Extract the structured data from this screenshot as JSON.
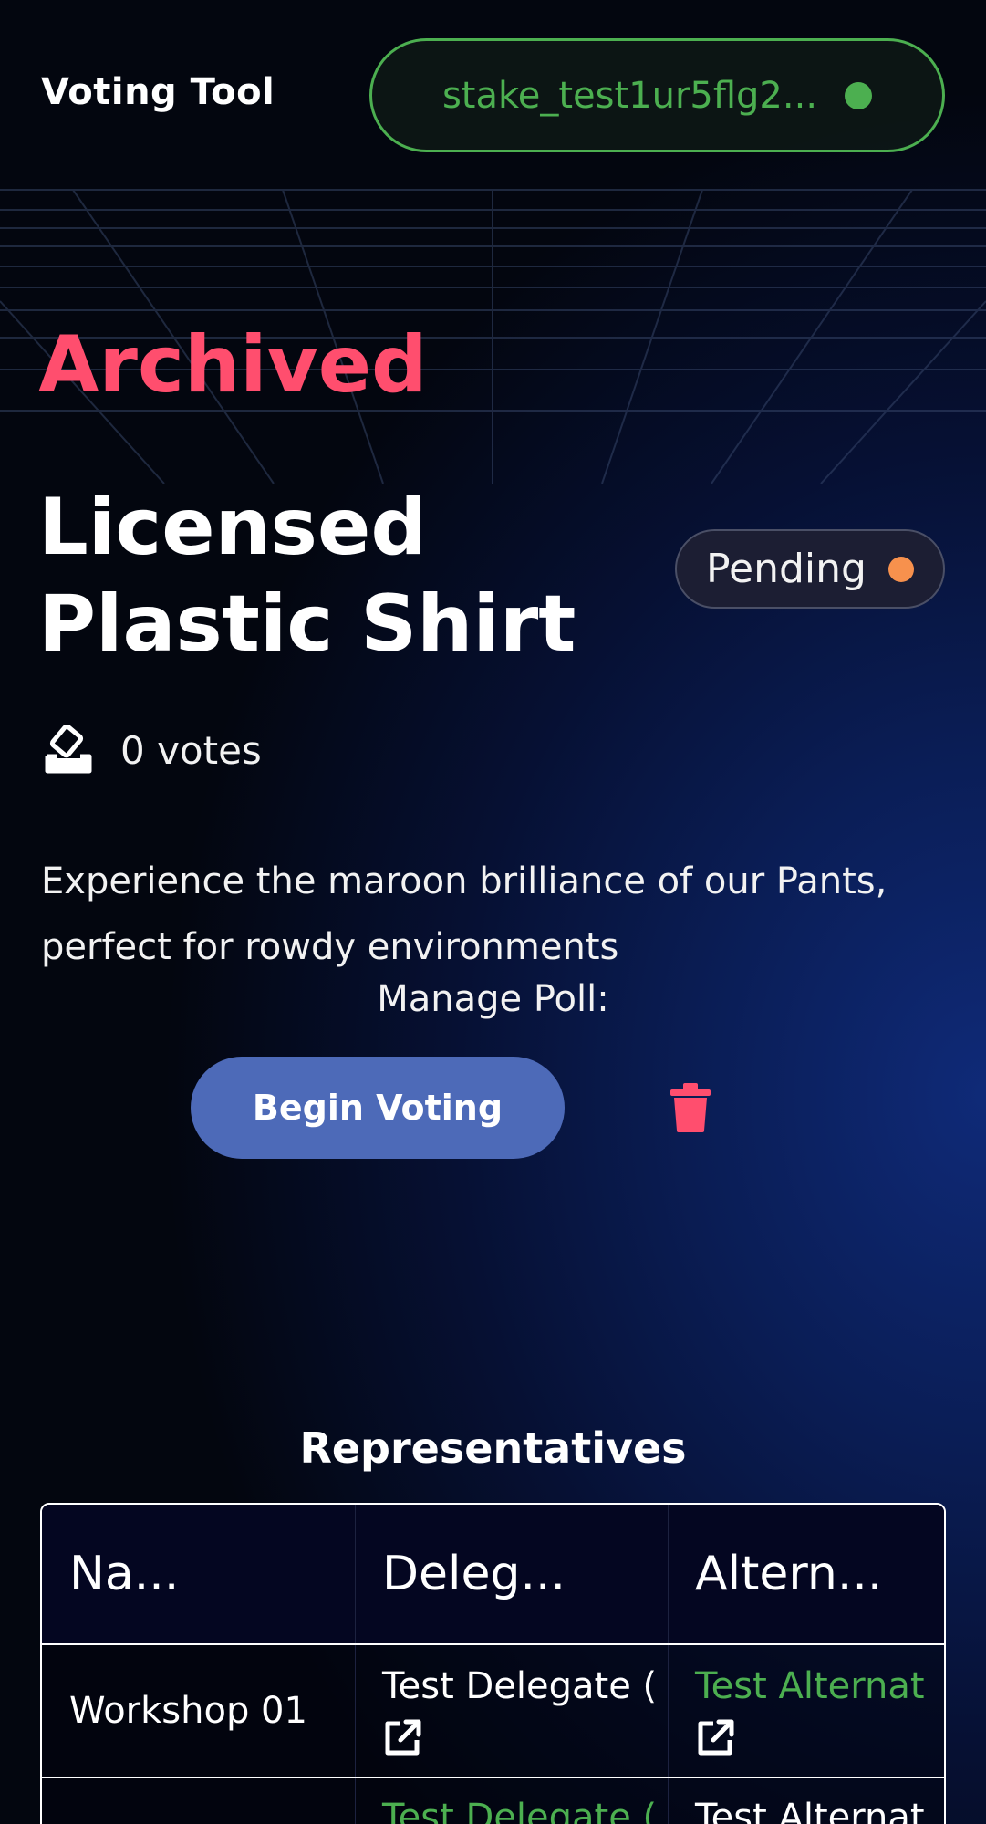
{
  "header": {
    "brand": "Voting Tool",
    "wallet_address": "stake_test1ur5flg2...",
    "wallet_status_color": "#4caf50"
  },
  "poll": {
    "archived_label": "Archived",
    "title": "Licensed Plastic Shirt",
    "status": "Pending",
    "status_color": "#f7914d",
    "votes": "0 votes",
    "description": "Experience the maroon brilliance of our Pants, perfect for rowdy environments",
    "manage_label": "Manage Poll:",
    "begin_button": "Begin Voting",
    "delete_icon": "trash-icon"
  },
  "representatives": {
    "title": "Representatives",
    "columns": [
      "Na...",
      "Deleg...",
      "Altern..."
    ],
    "rows": [
      {
        "name": "Workshop 01",
        "delegate": "Test Delegate (",
        "alternate": "Test Alternat"
      },
      {
        "name": "",
        "delegate": "Test Delegate (",
        "alternate": "Test Alternat"
      }
    ]
  },
  "colors": {
    "accent_pink": "#ff4e6e",
    "button_blue": "#4d6ab8",
    "link_green": "#4caf50"
  }
}
